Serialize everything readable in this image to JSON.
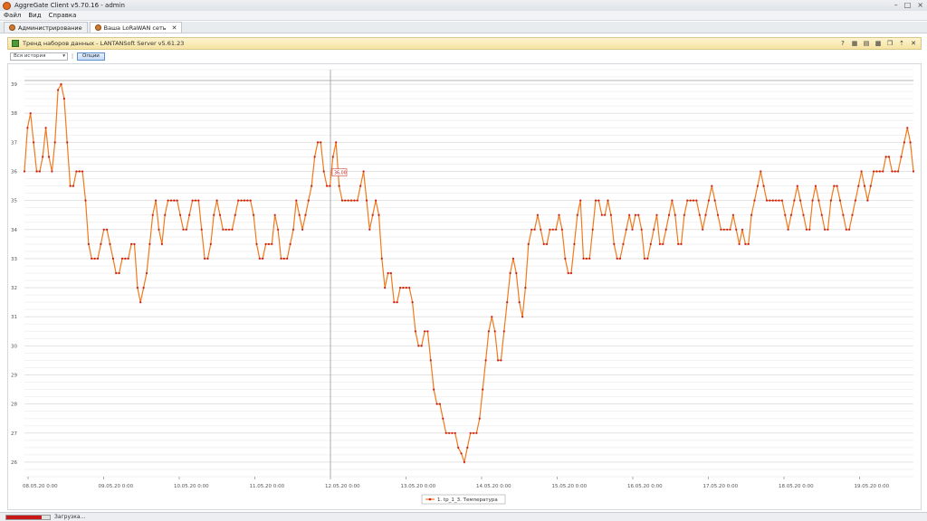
{
  "window": {
    "title": "AggreGate Client v5.70.16 - admin"
  },
  "menu": [
    "Файл",
    "Вид",
    "Справка"
  ],
  "tabs": [
    {
      "label": "Администрирование",
      "active": false
    },
    {
      "label": "Ваша LoRaWAN сеть",
      "active": true
    }
  ],
  "panel": {
    "title": "Тренд наборов данных - LANTANSoft Server v5.61.23"
  },
  "controls": {
    "range_value": "Вся история",
    "options_label": "Опции"
  },
  "status": {
    "text": "Загрузка...",
    "progress": 0.82
  },
  "colors": {
    "series": "#f07a1e",
    "point": "#c8201e"
  },
  "chart_data": {
    "type": "line",
    "x_tick_labels": [
      "08.05.20 0:00",
      "09.05.20 0:00",
      "10.05.20 0:00",
      "11.05.20 0:00",
      "12.05.20 0:00",
      "13.05.20 0:00",
      "14.05.20 0:00",
      "15.05.20 0:00",
      "16.05.20 0:00",
      "17.05.20 0:00",
      "18.05.20 0:00",
      "19.05.20 0:00"
    ],
    "ylim": [
      25.5,
      39.5
    ],
    "y_ticks": [
      26,
      27,
      28,
      29,
      30,
      31,
      32,
      33,
      34,
      35,
      36,
      37,
      38,
      39
    ],
    "grid": true,
    "legend_position": "bottom",
    "cursor_label": "36,00",
    "series": [
      {
        "name": "1. tp_1_3. Температура",
        "values": [
          36.0,
          37.5,
          38.0,
          37.0,
          36.0,
          36.0,
          36.5,
          37.5,
          36.5,
          36.0,
          37.0,
          38.8,
          39.0,
          38.5,
          37.0,
          35.5,
          35.5,
          36.0,
          36.0,
          36.0,
          35.0,
          33.5,
          33.0,
          33.0,
          33.0,
          33.5,
          34.0,
          34.0,
          33.5,
          33.0,
          32.5,
          32.5,
          33.0,
          33.0,
          33.0,
          33.5,
          33.5,
          32.0,
          31.5,
          32.0,
          32.5,
          33.5,
          34.5,
          35.0,
          34.0,
          33.5,
          34.5,
          35.0,
          35.0,
          35.0,
          35.0,
          34.5,
          34.0,
          34.0,
          34.5,
          35.0,
          35.0,
          35.0,
          34.0,
          33.0,
          33.0,
          33.5,
          34.5,
          35.0,
          34.5,
          34.0,
          34.0,
          34.0,
          34.0,
          34.5,
          35.0,
          35.0,
          35.0,
          35.0,
          35.0,
          34.5,
          33.5,
          33.0,
          33.0,
          33.5,
          33.5,
          33.5,
          34.5,
          34.0,
          33.0,
          33.0,
          33.0,
          33.5,
          34.0,
          35.0,
          34.5,
          34.0,
          34.5,
          35.0,
          35.5,
          36.5,
          37.0,
          37.0,
          36.0,
          35.5,
          35.5,
          36.5,
          37.0,
          35.5,
          35.0,
          35.0,
          35.0,
          35.0,
          35.0,
          35.0,
          35.5,
          36.0,
          35.0,
          34.0,
          34.5,
          35.0,
          34.5,
          33.0,
          32.0,
          32.5,
          32.5,
          31.5,
          31.5,
          32.0,
          32.0,
          32.0,
          32.0,
          31.5,
          30.5,
          30.0,
          30.0,
          30.5,
          30.5,
          29.5,
          28.5,
          28.0,
          28.0,
          27.5,
          27.0,
          27.0,
          27.0,
          27.0,
          26.5,
          26.3,
          26.0,
          26.5,
          27.0,
          27.0,
          27.0,
          27.5,
          28.5,
          29.5,
          30.5,
          31.0,
          30.5,
          29.5,
          29.5,
          30.5,
          31.5,
          32.5,
          33.0,
          32.5,
          31.5,
          31.0,
          32.0,
          33.5,
          34.0,
          34.0,
          34.5,
          34.0,
          33.5,
          33.5,
          34.0,
          34.0,
          34.0,
          34.5,
          34.0,
          33.0,
          32.5,
          32.5,
          33.5,
          34.5,
          35.0,
          33.0,
          33.0,
          33.0,
          34.0,
          35.0,
          35.0,
          34.5,
          34.5,
          35.0,
          34.5,
          33.5,
          33.0,
          33.0,
          33.5,
          34.0,
          34.5,
          34.0,
          34.5,
          34.5,
          34.0,
          33.0,
          33.0,
          33.5,
          34.0,
          34.5,
          33.5,
          33.5,
          34.0,
          34.5,
          35.0,
          34.5,
          33.5,
          33.5,
          34.5,
          35.0,
          35.0,
          35.0,
          35.0,
          34.5,
          34.0,
          34.5,
          35.0,
          35.5,
          35.0,
          34.5,
          34.0,
          34.0,
          34.0,
          34.0,
          34.5,
          34.0,
          33.5,
          34.0,
          33.5,
          33.5,
          34.5,
          35.0,
          35.5,
          36.0,
          35.5,
          35.0,
          35.0,
          35.0,
          35.0,
          35.0,
          35.0,
          34.5,
          34.0,
          34.5,
          35.0,
          35.5,
          35.0,
          34.5,
          34.0,
          34.0,
          35.0,
          35.5,
          35.0,
          34.5,
          34.0,
          34.0,
          35.0,
          35.5,
          35.5,
          35.0,
          34.5,
          34.0,
          34.0,
          34.5,
          35.0,
          35.5,
          36.0,
          35.5,
          35.0,
          35.5,
          36.0,
          36.0,
          36.0,
          36.0,
          36.5,
          36.5,
          36.0,
          36.0,
          36.0,
          36.5,
          37.0,
          37.5,
          37.0,
          36.0
        ]
      }
    ]
  }
}
